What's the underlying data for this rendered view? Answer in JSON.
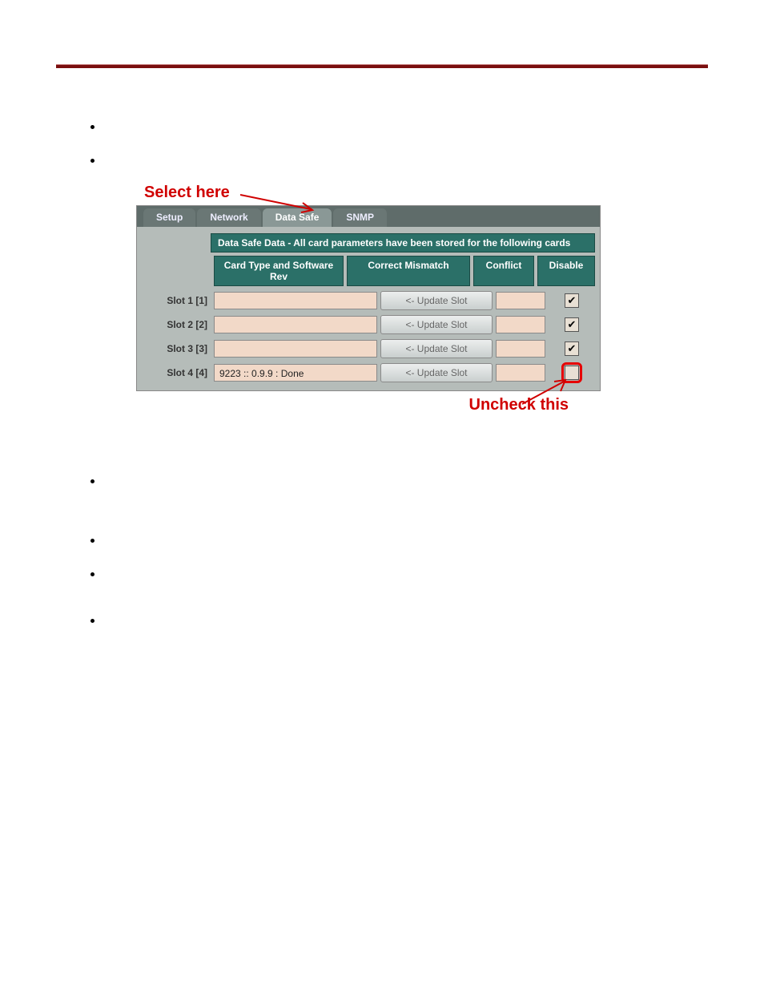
{
  "annotations": {
    "select_here": "Select  here",
    "uncheck_this": "Uncheck this"
  },
  "ui": {
    "tabs": {
      "setup": "Setup",
      "network": "Network",
      "data_safe": "Data Safe",
      "snmp": "SNMP"
    },
    "banner": "Data Safe Data - All card parameters have been stored for the following cards",
    "headers": {
      "card_type": "Card Type and Software Rev",
      "correct": "Correct Mismatch",
      "conflict": "Conflict",
      "disable": "Disable"
    },
    "update_label": "<- Update Slot",
    "rows": [
      {
        "slot": "Slot 1 [1]",
        "type": "",
        "checked": true
      },
      {
        "slot": "Slot 2 [2]",
        "type": "",
        "checked": true
      },
      {
        "slot": "Slot 3 [3]",
        "type": "",
        "checked": true
      },
      {
        "slot": "Slot 4 [4]",
        "type": "9223      :: 0.9.9 : Done",
        "checked": false
      }
    ]
  }
}
